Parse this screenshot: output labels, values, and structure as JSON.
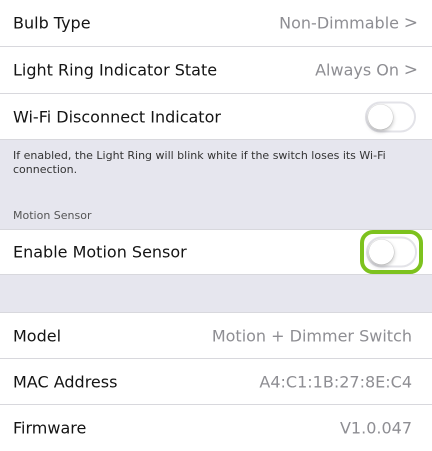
{
  "settings": {
    "bulb_type": {
      "label": "Bulb Type",
      "value": "Non-Dimmable"
    },
    "light_ring": {
      "label": "Light Ring Indicator State",
      "value": "Always On"
    },
    "wifi_disconnect": {
      "label": "Wi-Fi Disconnect Indicator",
      "enabled": false,
      "note": "If enabled, the Light Ring will blink white if the switch loses its Wi-Fi connection."
    },
    "chevron": ">"
  },
  "motion": {
    "section_title": "Motion Sensor",
    "enable_label": "Enable Motion Sensor",
    "enabled": false
  },
  "device_info": {
    "model": {
      "label": "Model",
      "value": "Motion + Dimmer Switch"
    },
    "mac": {
      "label": "MAC Address",
      "value": "A4:C1:1B:27:8E:C4"
    },
    "firmware": {
      "label": "Firmware",
      "value": "V1.0.047"
    }
  },
  "colors": {
    "highlight": "#7dc21e",
    "value_gray": "#8e8e93",
    "group_background": "#e6e6ee"
  }
}
